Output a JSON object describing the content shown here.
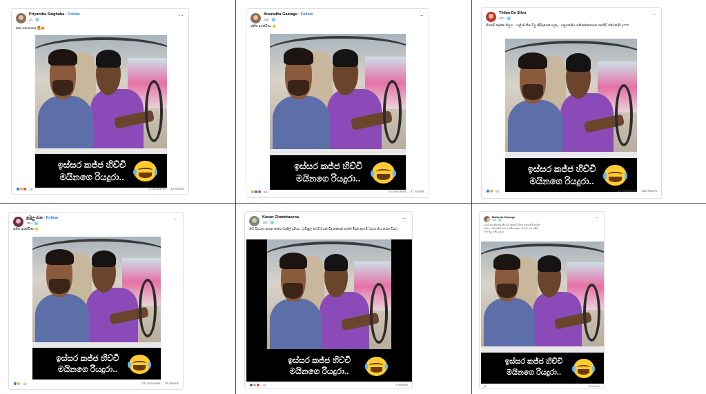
{
  "posts": [
    {
      "author": "Priyantha Singhaba",
      "follow": "Follow",
      "time": "2h",
      "caption": "අනා Comment 🤷😂",
      "meme_line1": "ඉස්සර කජ්ජ හිච්චි",
      "meme_line2": "මයිනගෙ රියදුරා..",
      "reaction_count": "18",
      "comments": "2 comments",
      "shares": "23 shares"
    },
    {
      "author": "Anuradha Gamage",
      "follow": "Follow",
      "time": "23h",
      "caption": "ජනිත ඉරක්ඩිණ 👍",
      "meme_line1": "ඉස්සර කජ්ජ හිච්චි",
      "meme_line2": "මයිනගෙ රියදුරා..",
      "reaction_count": "59",
      "comments": "5 comments",
      "shares": "47 shares"
    },
    {
      "author": "Thilan De Silva",
      "follow": "",
      "time": "21h",
      "caption": "ජීගනම් දෙන්න ගිහුහ ...හලි කි තීන වියු කීමීදාගෙන් ගල්දා .. ගනුගනකිය ගනීණ්තනයෙන් ගනගීව් හ්වෙනදිව දැ???",
      "meme_line1": "ඉස්සර කජ්ජ හිච්චි",
      "meme_line2": "මයිනගෙ රියදුරා..",
      "reaction_count": "84",
      "comments": "17 comments",
      "shares": "101 shares"
    },
    {
      "author": "ළමුලු ජාන",
      "follow": "Follow",
      "time": "16h",
      "caption": "ජනිත ඉරක්ඩිණ 👍",
      "meme_line1": "ඉස්සර කජ්ජ හිච්චි",
      "meme_line2": "මයිනගෙ රියදුරා..",
      "reaction_count": "46",
      "comments": "13 comments",
      "shares": "39 shares"
    },
    {
      "author": "Kavan Chandrasena",
      "follow": "",
      "time": "18h",
      "caption": "ගිහි විදුහතා ආගන කාශේ වැකිල් දුයියා.. (රවිනුල ගෙයි වගන් විදු කන්ගන් පැතේ මිදුන් නැගම් ධාරය නිය 2019 වියා)",
      "meme_line1": "ඉස්සර කජ්ජ හිච්චි",
      "meme_line2": "මයිනගෙ රියදුරා..",
      "reaction_count": "22",
      "comments": "",
      "shares": "3 shares"
    },
    {
      "author": "Mahinda Gamage",
      "follow": "",
      "time": "13h",
      "caption": "ගමේ ආගනිගනය් කිදු චිලගනගගි. දිනහ ඉනගනයි ආගින දුන්ගා. ගනි තහින් ගන් ගනයිය ආදාන. ගම ගිං ගහ ඉදින් ගන බිලු ගනිය දුදුගා.",
      "meme_line1": "ඉස්සර කජ්ජ හිච්චි",
      "meme_line2": "මයිනගෙ රියදුරා..",
      "reaction_count": "",
      "comments": "",
      "shares": "16 shares"
    }
  ]
}
